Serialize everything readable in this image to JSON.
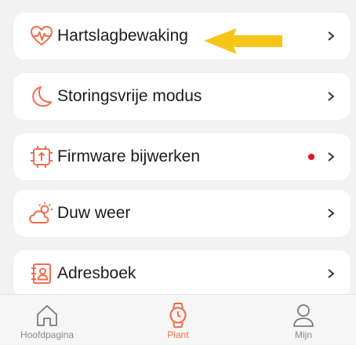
{
  "colors": {
    "accent": "#f26c4f",
    "arrow": "#f5c518",
    "badge": "#e8101c"
  },
  "menu": [
    {
      "label": "Hartslagbewaking",
      "icon": "heart-rate-icon",
      "badge": false
    },
    {
      "label": "Storingsvrije modus",
      "icon": "moon-icon",
      "badge": false
    },
    {
      "label": "Firmware bijwerken",
      "icon": "firmware-update-icon",
      "badge": true
    },
    {
      "label": "Duw weer",
      "icon": "weather-icon",
      "badge": false
    },
    {
      "label": "Adresboek",
      "icon": "address-book-icon",
      "badge": false
    }
  ],
  "tabbar": [
    {
      "label": "Hoofdpagina",
      "icon": "home-icon",
      "active": false
    },
    {
      "label": "Plant",
      "icon": "watch-icon",
      "active": true
    },
    {
      "label": "Mijn",
      "icon": "profile-icon",
      "active": false
    }
  ]
}
